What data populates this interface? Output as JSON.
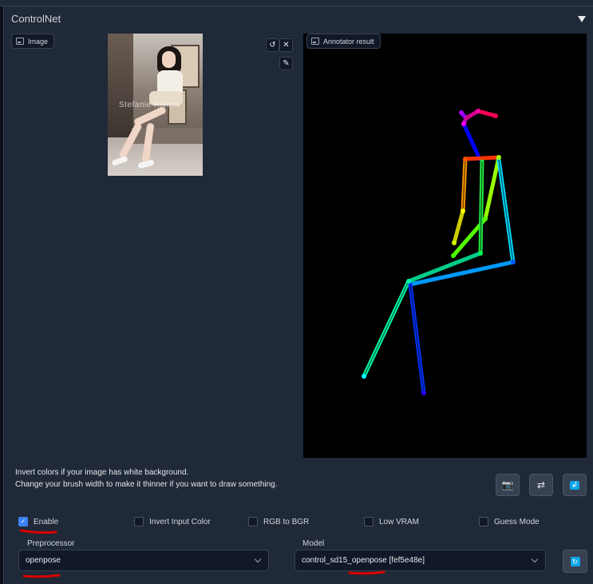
{
  "panel": {
    "title": "ControlNet"
  },
  "image_input": {
    "label": "Image",
    "photo_watermark": "Stefanie Rivera"
  },
  "annotator": {
    "label": "Annotator result"
  },
  "hints": {
    "line1": "Invert colors if your image has white background.",
    "line2": "Change your brush width to make it thinner if you want to draw something."
  },
  "checkboxes": [
    {
      "label": "Enable",
      "checked": true
    },
    {
      "label": "Invert Input Color",
      "checked": false
    },
    {
      "label": "RGB to BGR",
      "checked": false
    },
    {
      "label": "Low VRAM",
      "checked": false
    },
    {
      "label": "Guess Mode",
      "checked": false
    }
  ],
  "preprocessor": {
    "label": "Preprocessor",
    "value": "openpose"
  },
  "model": {
    "label": "Model",
    "value": "control_sd15_openpose [fef5e48e]"
  },
  "icons": {
    "undo": "undo-icon",
    "close": "close-icon",
    "brush": "brush-icon",
    "camera": "camera-icon",
    "swap": "swap-icon",
    "send": "send-icon",
    "refresh": "refresh-icon"
  },
  "colors": {
    "accent": "#3b82f6",
    "panel_bg": "#1f2937",
    "page_bg": "#0b0f19",
    "annotation_marks": "#d90000"
  }
}
